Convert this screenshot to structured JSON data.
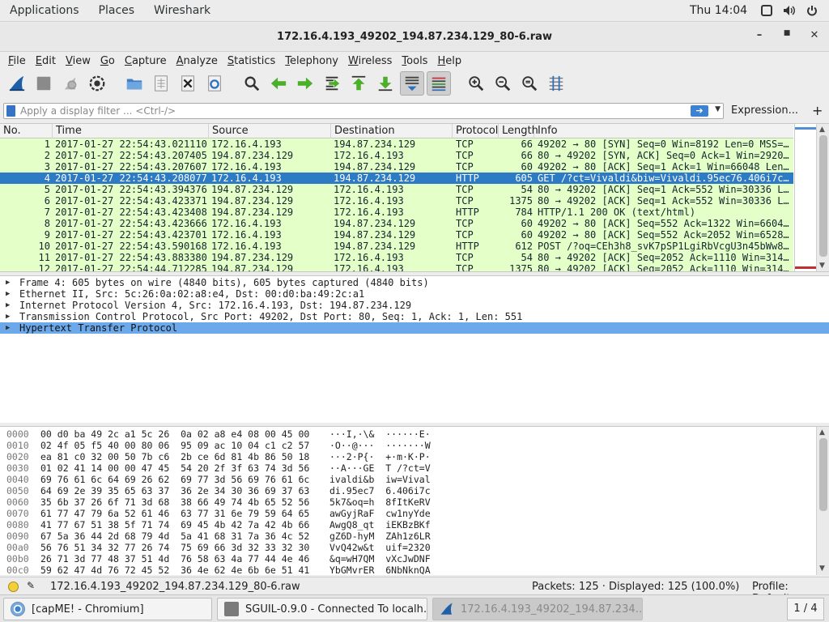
{
  "topbar": {
    "menus": [
      "Applications",
      "Places",
      "Wireshark"
    ],
    "clock": "Thu 14:04"
  },
  "window": {
    "title": "172.16.4.193_49202_194.87.234.129_80-6.raw"
  },
  "menubar": [
    "File",
    "Edit",
    "View",
    "Go",
    "Capture",
    "Analyze",
    "Statistics",
    "Telephony",
    "Wireless",
    "Tools",
    "Help"
  ],
  "filter": {
    "placeholder": "Apply a display filter ... <Ctrl-/>",
    "expression_label": "Expression...",
    "add_label": "+"
  },
  "packet_list": {
    "columns": [
      "No.",
      "Time",
      "Source",
      "Destination",
      "Protocol",
      "Length",
      "Info"
    ],
    "selected_index": 3,
    "rows": [
      {
        "no": "1",
        "time": "2017-01-27 22:54:43.021110",
        "src": "172.16.4.193",
        "dst": "194.87.234.129",
        "proto": "TCP",
        "len": "66",
        "info": "49202 → 80 [SYN] Seq=0 Win=8192 Len=0 MSS=…"
      },
      {
        "no": "2",
        "time": "2017-01-27 22:54:43.207405",
        "src": "194.87.234.129",
        "dst": "172.16.4.193",
        "proto": "TCP",
        "len": "66",
        "info": "80 → 49202 [SYN, ACK] Seq=0 Ack=1 Win=2920…"
      },
      {
        "no": "3",
        "time": "2017-01-27 22:54:43.207607",
        "src": "172.16.4.193",
        "dst": "194.87.234.129",
        "proto": "TCP",
        "len": "60",
        "info": "49202 → 80 [ACK] Seq=1 Ack=1 Win=66048 Len…"
      },
      {
        "no": "4",
        "time": "2017-01-27 22:54:43.208077",
        "src": "172.16.4.193",
        "dst": "194.87.234.129",
        "proto": "HTTP",
        "len": "605",
        "info": "GET /?ct=Vivaldi&biw=Vivaldi.95ec76.406i7c…"
      },
      {
        "no": "5",
        "time": "2017-01-27 22:54:43.394376",
        "src": "194.87.234.129",
        "dst": "172.16.4.193",
        "proto": "TCP",
        "len": "54",
        "info": "80 → 49202 [ACK] Seq=1 Ack=552 Win=30336 L…"
      },
      {
        "no": "6",
        "time": "2017-01-27 22:54:43.423371",
        "src": "194.87.234.129",
        "dst": "172.16.4.193",
        "proto": "TCP",
        "len": "1375",
        "info": "80 → 49202 [ACK] Seq=1 Ack=552 Win=30336 L…"
      },
      {
        "no": "7",
        "time": "2017-01-27 22:54:43.423408",
        "src": "194.87.234.129",
        "dst": "172.16.4.193",
        "proto": "HTTP",
        "len": "784",
        "info": "HTTP/1.1 200 OK  (text/html)"
      },
      {
        "no": "8",
        "time": "2017-01-27 22:54:43.423666",
        "src": "172.16.4.193",
        "dst": "194.87.234.129",
        "proto": "TCP",
        "len": "60",
        "info": "49202 → 80 [ACK] Seq=552 Ack=1322 Win=6604…"
      },
      {
        "no": "9",
        "time": "2017-01-27 22:54:43.423701",
        "src": "172.16.4.193",
        "dst": "194.87.234.129",
        "proto": "TCP",
        "len": "60",
        "info": "49202 → 80 [ACK] Seq=552 Ack=2052 Win=6528…"
      },
      {
        "no": "10",
        "time": "2017-01-27 22:54:43.590168",
        "src": "172.16.4.193",
        "dst": "194.87.234.129",
        "proto": "HTTP",
        "len": "612",
        "info": "POST /?oq=CEh3h8_svK7pSP1LgiRbVcgU3n45bWw8…"
      },
      {
        "no": "11",
        "time": "2017-01-27 22:54:43.883380",
        "src": "194.87.234.129",
        "dst": "172.16.4.193",
        "proto": "TCP",
        "len": "54",
        "info": "80 → 49202 [ACK] Seq=2052 Ack=1110 Win=314…"
      },
      {
        "no": "12",
        "time": "2017-01-27 22:54:44.712285",
        "src": "194.87.234.129",
        "dst": "172.16.4.193",
        "proto": "TCP",
        "len": "1375",
        "info": "80 → 49202 [ACK] Seq=2052 Ack=1110 Win=314…"
      }
    ]
  },
  "details": {
    "selected_index": 4,
    "rows": [
      "Frame 4: 605 bytes on wire (4840 bits), 605 bytes captured (4840 bits)",
      "Ethernet II, Src: 5c:26:0a:02:a8:e4, Dst: 00:d0:ba:49:2c:a1",
      "Internet Protocol Version 4, Src: 172.16.4.193, Dst: 194.87.234.129",
      "Transmission Control Protocol, Src Port: 49202, Dst Port: 80, Seq: 1, Ack: 1, Len: 551",
      "Hypertext Transfer Protocol"
    ]
  },
  "bytes": {
    "rows": [
      {
        "off": "0000",
        "hex": "00 d0 ba 49 2c a1 5c 26  0a 02 a8 e4 08 00 45 00",
        "ascii": "···I,·\\&  ······E·"
      },
      {
        "off": "0010",
        "hex": "02 4f 05 f5 40 00 80 06  95 09 ac 10 04 c1 c2 57",
        "ascii": "·O··@···  ·······W"
      },
      {
        "off": "0020",
        "hex": "ea 81 c0 32 00 50 7b c6  2b ce 6d 81 4b 86 50 18",
        "ascii": "···2·P{·  +·m·K·P·"
      },
      {
        "off": "0030",
        "hex": "01 02 41 14 00 00 47 45  54 20 2f 3f 63 74 3d 56",
        "ascii": "··A···GE  T /?ct=V"
      },
      {
        "off": "0040",
        "hex": "69 76 61 6c 64 69 26 62  69 77 3d 56 69 76 61 6c",
        "ascii": "ivaldi&b  iw=Vival"
      },
      {
        "off": "0050",
        "hex": "64 69 2e 39 35 65 63 37  36 2e 34 30 36 69 37 63",
        "ascii": "di.95ec7  6.406i7c"
      },
      {
        "off": "0060",
        "hex": "35 6b 37 26 6f 71 3d 68  38 66 49 74 4b 65 52 56",
        "ascii": "5k7&oq=h  8fItKeRV"
      },
      {
        "off": "0070",
        "hex": "61 77 47 79 6a 52 61 46  63 77 31 6e 79 59 64 65",
        "ascii": "awGyjRaF  cw1nyYde"
      },
      {
        "off": "0080",
        "hex": "41 77 67 51 38 5f 71 74  69 45 4b 42 7a 42 4b 66",
        "ascii": "AwgQ8_qt  iEKBzBKf"
      },
      {
        "off": "0090",
        "hex": "67 5a 36 44 2d 68 79 4d  5a 41 68 31 7a 36 4c 52",
        "ascii": "gZ6D-hyM  ZAh1z6LR"
      },
      {
        "off": "00a0",
        "hex": "56 76 51 34 32 77 26 74  75 69 66 3d 32 33 32 30",
        "ascii": "VvQ42w&t  uif=2320"
      },
      {
        "off": "00b0",
        "hex": "26 71 3d 77 48 37 51 4d  76 58 63 4a 77 44 4e 46",
        "ascii": "&q=wH7QM  vXcJwDNF"
      },
      {
        "off": "00c0",
        "hex": "59 62 47 4d 76 72 45 52  36 4e 62 4e 6b 6e 51 41",
        "ascii": "YbGMvrER  6NbNknQA"
      }
    ]
  },
  "status": {
    "file": "172.16.4.193_49202_194.87.234.129_80-6.raw",
    "packets": "Packets: 125 · Displayed: 125 (100.0%)",
    "profile": "Profile: Default"
  },
  "taskbar": {
    "tasks": [
      "[capME! - Chromium]",
      "SGUIL-0.9.0 - Connected To localh…",
      "172.16.4.193_49202_194.87.234…"
    ],
    "workspace": "1 / 4"
  },
  "colors": {
    "tcp_row": "#e4ffc7",
    "selected_row": "#2d7bc5",
    "selected_detail": "#6ba9ea",
    "shark_blue": "#1f5fa8"
  }
}
